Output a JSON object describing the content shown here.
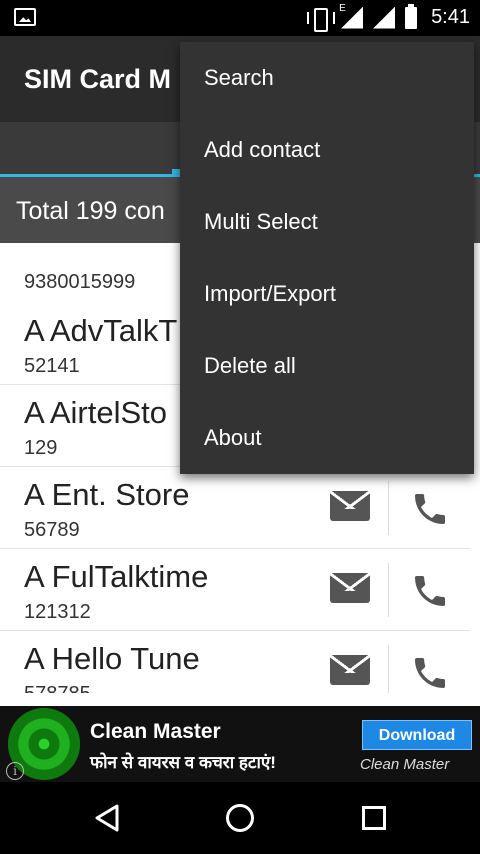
{
  "status_bar": {
    "time": "5:41",
    "network_type": "E",
    "icons": [
      "image-icon",
      "vibrate-icon",
      "signal-icon",
      "wifi-signal-icon",
      "battery-icon"
    ]
  },
  "app_bar": {
    "title": "SIM Card M"
  },
  "summary": {
    "total_text": "Total 199 con"
  },
  "contacts": {
    "first_partial_number": "9380015999",
    "items": [
      {
        "name": "A AdvTalkT",
        "number": "52141"
      },
      {
        "name": "A AirtelSto",
        "number": "129"
      },
      {
        "name": "A Ent. Store",
        "number": "56789"
      },
      {
        "name": "A FulTalktime",
        "number": "121312"
      },
      {
        "name": "A Hello Tune",
        "number": "578785"
      }
    ]
  },
  "menu": {
    "items": [
      "Search",
      "Add contact",
      "Multi Select",
      "Import/Export",
      "Delete all",
      "About"
    ]
  },
  "ad": {
    "title": "Clean Master",
    "subtitle": "फोन से वायरस व कचरा हटाएं!",
    "button": "Download",
    "brand": "Clean Master",
    "info_label": "i"
  },
  "colors": {
    "accent": "#33b5e5",
    "menu_bg": "#333333",
    "app_bar": "#2b2b2b"
  }
}
